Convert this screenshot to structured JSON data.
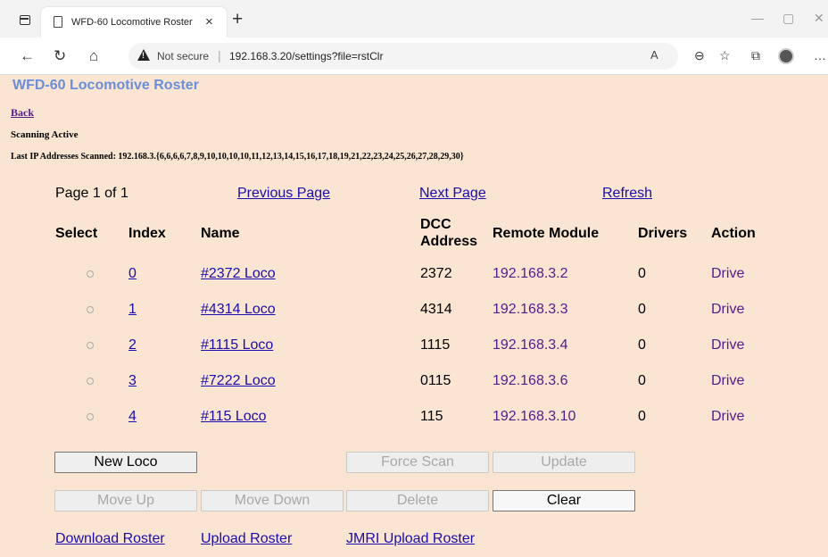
{
  "browser": {
    "tab_title": "WFD-60 Locomotive Roster",
    "security_label": "Not secure",
    "url": "192.168.3.20/settings?file=rstClr"
  },
  "page": {
    "title": "WFD-60 Locomotive Roster",
    "back_label": "Back",
    "status": "Scanning Active",
    "last_scanned": "Last IP Addresses Scanned: 192.168.3.{6,6,6,6,7,8,9,10,10,10,10,11,12,13,14,15,16,17,18,19,21,22,23,24,25,26,27,28,29,30}"
  },
  "pagination": {
    "page_info": "Page 1 of 1",
    "previous": "Previous Page",
    "next": "Next Page",
    "refresh": "Refresh"
  },
  "table": {
    "headers": {
      "select": "Select",
      "index": "Index",
      "name": "Name",
      "dcc_line1": "DCC",
      "dcc_line2": "Address",
      "remote": "Remote Module",
      "drivers": "Drivers",
      "action": "Action"
    },
    "rows": [
      {
        "index": "0",
        "name": "#2372 Loco",
        "dcc": "2372",
        "remote": "192.168.3.2",
        "drivers": "0",
        "action": "Drive"
      },
      {
        "index": "1",
        "name": "#4314 Loco",
        "dcc": "4314",
        "remote": "192.168.3.3",
        "drivers": "0",
        "action": "Drive"
      },
      {
        "index": "2",
        "name": "#1115 Loco",
        "dcc": "1115",
        "remote": "192.168.3.4",
        "drivers": "0",
        "action": "Drive"
      },
      {
        "index": "3",
        "name": "#7222 Loco",
        "dcc": "0115",
        "remote": "192.168.3.6",
        "drivers": "0",
        "action": "Drive"
      },
      {
        "index": "4",
        "name": "#115 Loco",
        "dcc": "115",
        "remote": "192.168.3.10",
        "drivers": "0",
        "action": "Drive"
      }
    ]
  },
  "buttons": {
    "new_loco": "New Loco",
    "force_scan": "Force Scan",
    "update": "Update",
    "move_up": "Move Up",
    "move_down": "Move Down",
    "delete": "Delete",
    "clear": "Clear"
  },
  "links": {
    "download": "Download Roster",
    "upload": "Upload Roster",
    "jmri": "JMRI Upload Roster"
  },
  "colors": {
    "page_background": "#fae5d3",
    "title": "#6a8fd8",
    "link": "#1a0dab",
    "visited_link": "#551a8b"
  }
}
